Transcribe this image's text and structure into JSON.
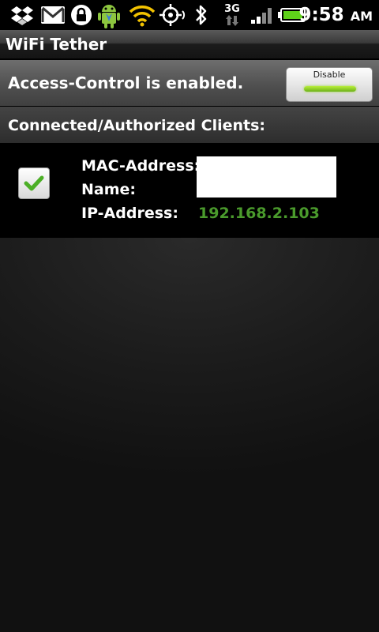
{
  "status_bar": {
    "time": "9:58",
    "ampm": "AM",
    "network_type": "3G",
    "icons": [
      "dropbox-icon",
      "gmail-icon",
      "lock-app-icon",
      "android-icon",
      "wifi-hotspot-icon",
      "gps-icon",
      "bluetooth-icon",
      "3g-data-icon",
      "signal-icon",
      "battery-icon"
    ],
    "colors": {
      "wifi": "#f2c200",
      "battery": "#5fd21a"
    }
  },
  "app": {
    "title": "WiFi Tether"
  },
  "access_control": {
    "status_text": "Access-Control is enabled.",
    "toggle_label": "Disable",
    "toggle_light_color": "#8ed424"
  },
  "clients_section": {
    "title": "Connected/Authorized Clients:",
    "clients": [
      {
        "authorized": true,
        "mac_label": "MAC-Address:",
        "name_label": "Name:",
        "ip_label": "IP-Address:",
        "ip_value": "192.168.2.103",
        "ip_color": "#4a9a2c"
      }
    ]
  }
}
